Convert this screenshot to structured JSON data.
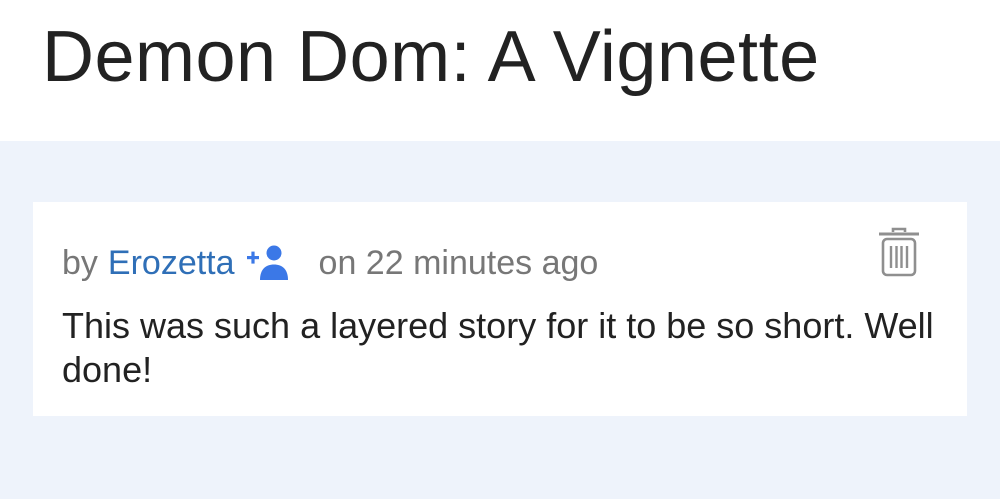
{
  "page": {
    "title": "Demon Dom: A Vignette"
  },
  "comment": {
    "by_label": "by",
    "author": "Erozetta",
    "time_text": "on 22 minutes ago",
    "body": "This was such a layered story for it to be so short. Well done!"
  },
  "icons": {
    "follow": "add-user-icon",
    "delete": "trash-icon"
  },
  "colors": {
    "page_background": "#eef3fb",
    "card_background": "#ffffff",
    "author_link": "#2f6fb7",
    "follow_icon": "#3b78e7",
    "delete_icon": "#8f8f8f",
    "meta_text": "#777777",
    "title_text": "#222222"
  }
}
